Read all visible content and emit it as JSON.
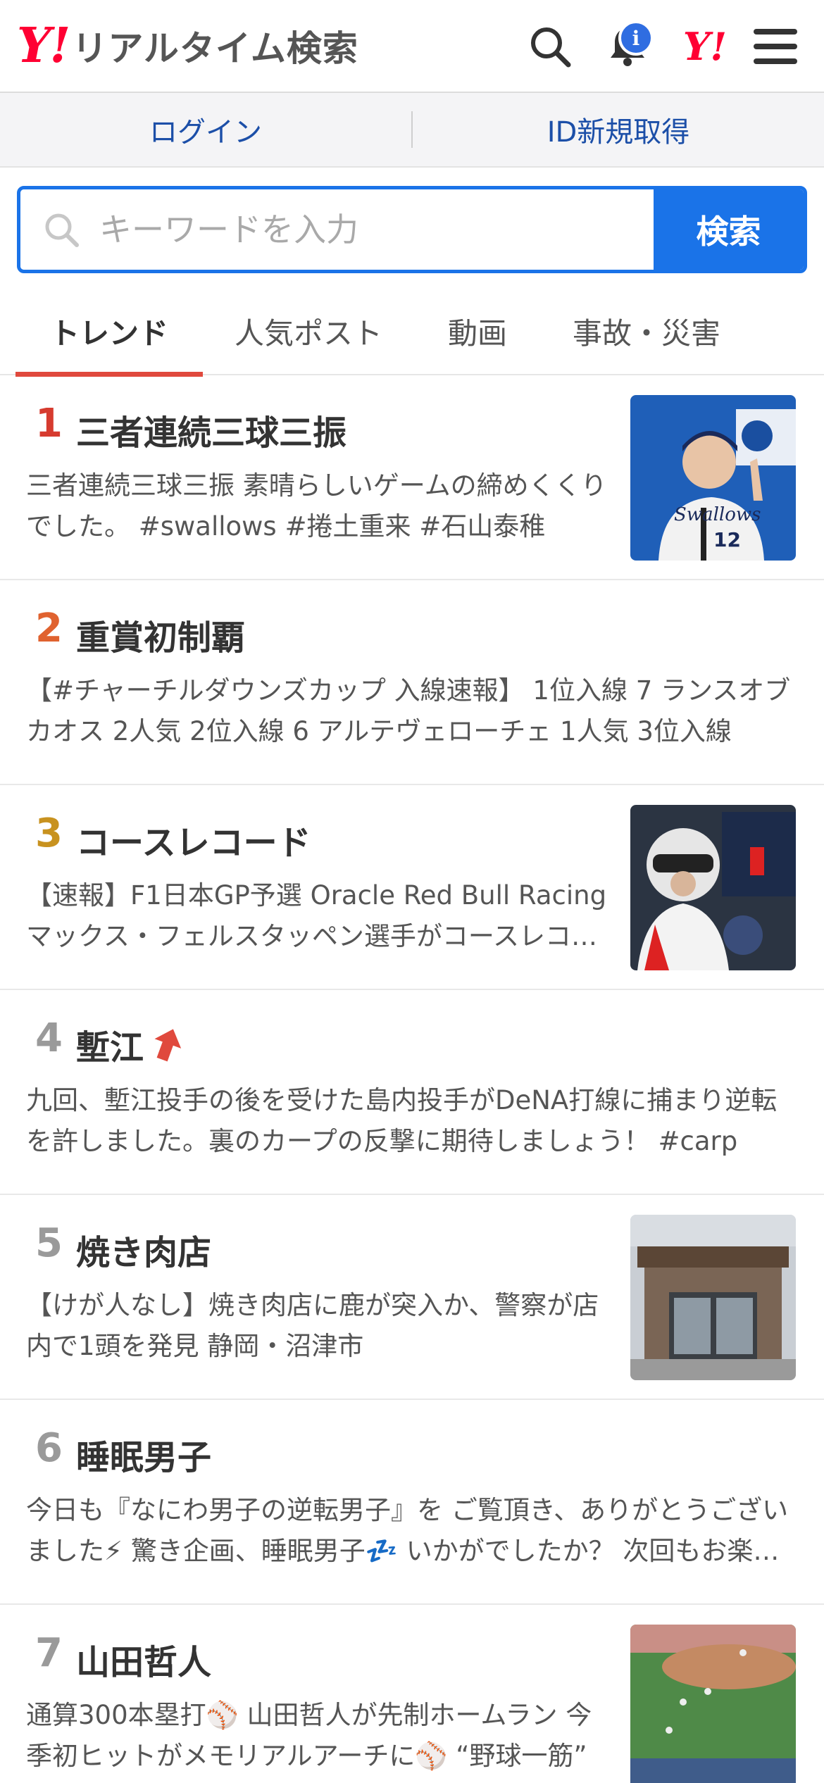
{
  "header": {
    "logo_mark": "Y!",
    "logo_text": "リアルタイム検索",
    "notification_badge": "i",
    "ymark": "Y!"
  },
  "account": {
    "login": "ログイン",
    "signup": "ID新規取得"
  },
  "search": {
    "placeholder": "キーワードを入力",
    "button": "検索"
  },
  "tabs": [
    {
      "label": "トレンド",
      "active": true
    },
    {
      "label": "人気ポスト",
      "active": false
    },
    {
      "label": "動画",
      "active": false
    },
    {
      "label": "事故・災害",
      "active": false
    }
  ],
  "trends": [
    {
      "rank": "1",
      "title": "三者連続三球三振",
      "desc": "三者連続三球三振 素晴らしいゲームの締めくくりでした。 #swallows #捲土重来 #石山泰稚",
      "rank_color": "#d63b2f"
    },
    {
      "rank": "2",
      "title": "重賞初制覇",
      "desc": "【#チャーチルダウンズカップ 入線速報】 1位入線 7 ランスオブカオス 2人気 2位入線 6 アルテヴェローチェ 1人気 3位入線",
      "rank_color": "#e0622f"
    },
    {
      "rank": "3",
      "title": "コースレコード",
      "desc": "【速報】F1日本GP予選 Oracle Red Bull Racing マックス・フェルスタッペン選手がコースレコードでポールポジション獲得",
      "rank_color": "#c8921f"
    },
    {
      "rank": "4",
      "title": "塹江",
      "desc": "九回、塹江投手の後を受けた島内投手がDeNA打線に捕まり逆転を許しました。裏のカープの反撃に期待しましょう！ #carp",
      "rank_color": "#9a9a9a"
    },
    {
      "rank": "5",
      "title": "焼き肉店",
      "desc": "【けが人なし】焼き肉店に鹿が突入か、警察が店内で1頭を発見 静岡・沼津市",
      "rank_color": "#9a9a9a"
    },
    {
      "rank": "6",
      "title": "睡眠男子",
      "desc": "今日も『なにわ男子の逆転男子』を ご覧頂き、ありがとうございました⚡ 驚き企画、睡眠男子💤 いかがでしたか？ 次回もお楽しみに",
      "rank_color": "#9a9a9a"
    },
    {
      "rank": "7",
      "title": "山田哲人",
      "desc": "通算300本塁打⚾ 山田哲人が先制ホームラン 今季初ヒットがメモリアルアーチに⚾ “野球一筋”",
      "rank_color": "#9a9a9a"
    }
  ]
}
